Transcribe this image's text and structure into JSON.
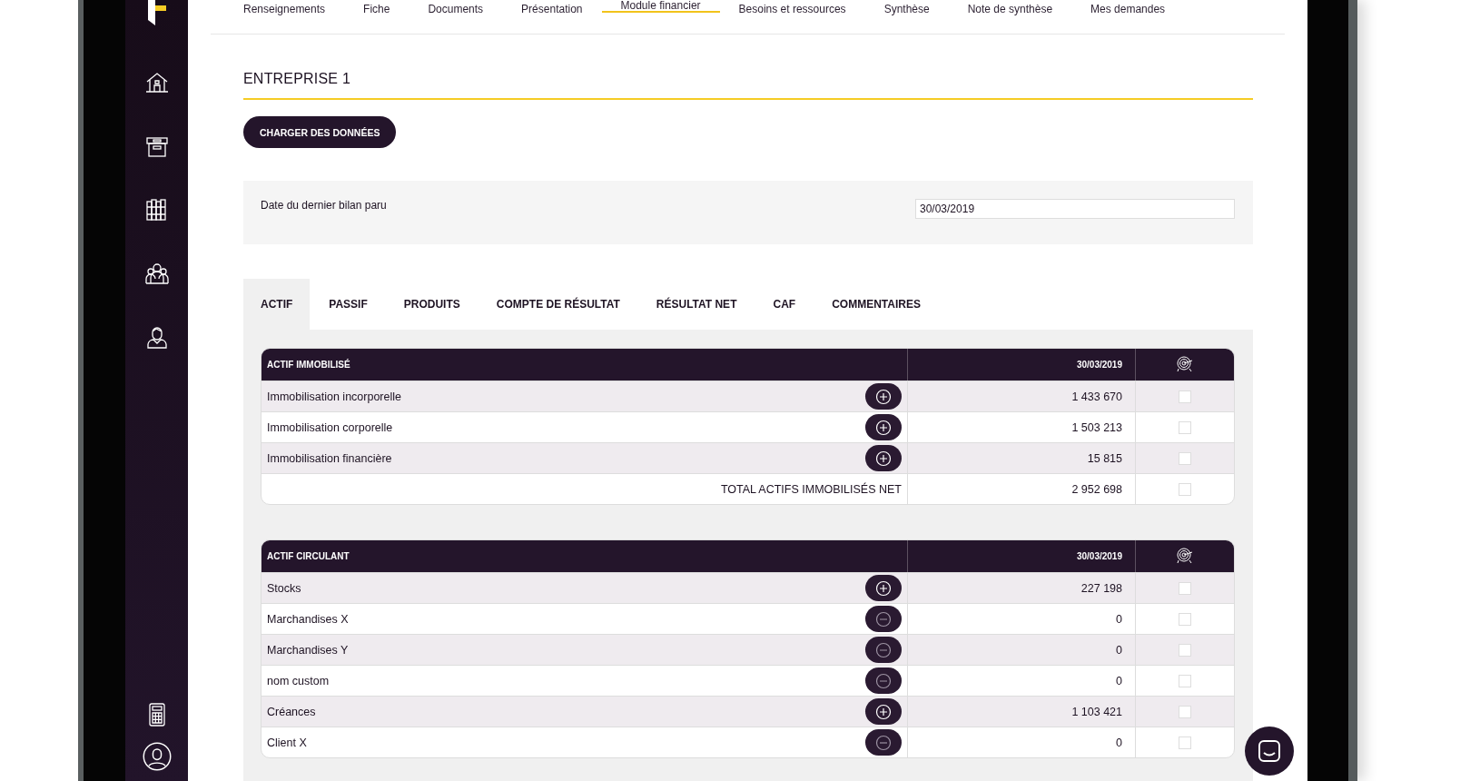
{
  "nav": [
    {
      "label": "Renseignements",
      "selected": false
    },
    {
      "label": "Fiche",
      "selected": false
    },
    {
      "label": "Documents",
      "selected": false
    },
    {
      "label": "Présentation",
      "selected": false
    },
    {
      "label": "Module financier",
      "selected": true
    },
    {
      "label": "Besoins et ressources",
      "selected": false
    },
    {
      "label": "Synthèse",
      "selected": false
    },
    {
      "label": "Note de synthèse",
      "selected": false
    },
    {
      "label": "Mes demandes",
      "selected": false
    }
  ],
  "title": "ENTREPRISE 1",
  "load_button": "CHARGER DES DONNÉES",
  "date_field": {
    "label": "Date du dernier bilan paru",
    "value": "30/03/2019"
  },
  "tabs": [
    {
      "label": "ACTIF",
      "selected": true
    },
    {
      "label": "PASSIF",
      "selected": false
    },
    {
      "label": "PRODUITS",
      "selected": false
    },
    {
      "label": "COMPTE DE RÉSULTAT",
      "selected": false
    },
    {
      "label": "RÉSULTAT NET",
      "selected": false
    },
    {
      "label": "CAF",
      "selected": false
    },
    {
      "label": "COMMENTAIRES",
      "selected": false
    }
  ],
  "tables": [
    {
      "title": "ACTIF IMMOBILISÉ",
      "date": "30/03/2019",
      "rows": [
        {
          "kind": "expandable",
          "label": "Immobilisation incorporelle",
          "value": "1 433 670",
          "checked": false
        },
        {
          "kind": "expandable",
          "label": "Immobilisation corporelle",
          "value": "1 503 213",
          "checked": false
        },
        {
          "kind": "expandable",
          "label": "Immobilisation financière",
          "value": "15 815",
          "checked": false
        },
        {
          "kind": "total",
          "label": "TOTAL ACTIFS IMMOBILISÉS NET",
          "value": "2 952 698",
          "checked": false
        }
      ]
    },
    {
      "title": "ACTIF CIRCULANT",
      "date": "30/03/2019",
      "rows": [
        {
          "kind": "expandable",
          "label": "Stocks",
          "value": "227 198",
          "checked": false
        },
        {
          "kind": "collapsible",
          "label": "Marchandises X",
          "value": "0",
          "checked": false
        },
        {
          "kind": "collapsible",
          "label": "Marchandises Y",
          "value": "0",
          "checked": false
        },
        {
          "kind": "collapsible",
          "label": "nom custom",
          "value": "0",
          "checked": false
        },
        {
          "kind": "expandable",
          "label": "Créances",
          "value": "1 103 421",
          "checked": false
        },
        {
          "kind": "collapsible",
          "label": "Client X",
          "value": "0",
          "checked": false
        }
      ]
    }
  ]
}
